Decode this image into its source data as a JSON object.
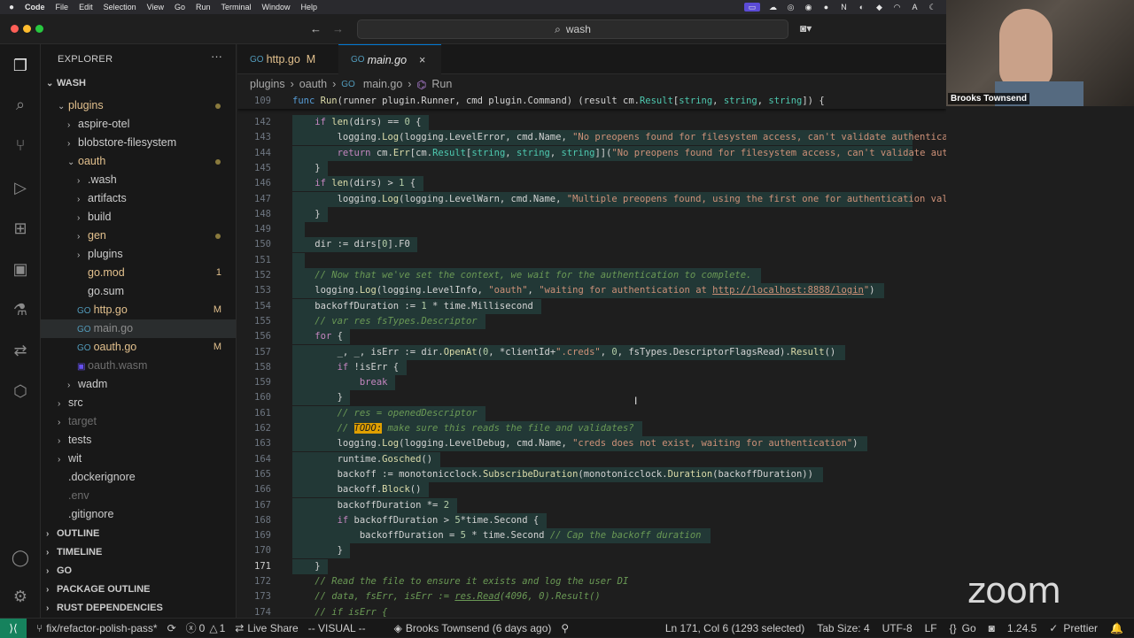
{
  "menubar": {
    "app": "Code",
    "items": [
      "File",
      "Edit",
      "Selection",
      "View",
      "Go",
      "Run",
      "Terminal",
      "Window",
      "Help"
    ]
  },
  "titlebar": {
    "search": "wash"
  },
  "sidebar": {
    "header": "EXPLORER",
    "root": "WASH",
    "tree": [
      {
        "label": "plugins",
        "indent": 1,
        "type": "folder",
        "open": true,
        "color": "#e2c08d",
        "dot": true
      },
      {
        "label": "aspire-otel",
        "indent": 2,
        "type": "folder",
        "open": false,
        "color": "#cccccc"
      },
      {
        "label": "blobstore-filesystem",
        "indent": 2,
        "type": "folder",
        "open": false,
        "color": "#cccccc"
      },
      {
        "label": "oauth",
        "indent": 2,
        "type": "folder",
        "open": true,
        "color": "#e2c08d",
        "dot": true
      },
      {
        "label": ".wash",
        "indent": 3,
        "type": "folder",
        "open": false,
        "color": "#cccccc"
      },
      {
        "label": "artifacts",
        "indent": 3,
        "type": "folder",
        "open": false,
        "color": "#cccccc"
      },
      {
        "label": "build",
        "indent": 3,
        "type": "folder",
        "open": false,
        "color": "#cccccc"
      },
      {
        "label": "gen",
        "indent": 3,
        "type": "folder",
        "open": false,
        "color": "#e2c08d",
        "dot": true
      },
      {
        "label": "plugins",
        "indent": 3,
        "type": "folder",
        "open": false,
        "color": "#cccccc"
      },
      {
        "label": "go.mod",
        "indent": 3,
        "type": "file",
        "color": "#e2c08d",
        "badge": "1"
      },
      {
        "label": "go.sum",
        "indent": 3,
        "type": "file",
        "color": "#cccccc"
      },
      {
        "label": "http.go",
        "indent": 3,
        "type": "go",
        "color": "#e2c08d",
        "badge": "M"
      },
      {
        "label": "main.go",
        "indent": 3,
        "type": "go",
        "color": "#8c8c8c",
        "selected": true
      },
      {
        "label": "oauth.go",
        "indent": 3,
        "type": "go",
        "color": "#e2c08d",
        "badge": "M"
      },
      {
        "label": "oauth.wasm",
        "indent": 3,
        "type": "wasm",
        "color": "#6e6e6e"
      },
      {
        "label": "wadm",
        "indent": 2,
        "type": "folder",
        "open": false,
        "color": "#cccccc"
      },
      {
        "label": "src",
        "indent": 1,
        "type": "folder",
        "open": false,
        "color": "#cccccc"
      },
      {
        "label": "target",
        "indent": 1,
        "type": "folder",
        "open": false,
        "color": "#6e6e6e"
      },
      {
        "label": "tests",
        "indent": 1,
        "type": "folder",
        "open": false,
        "color": "#cccccc"
      },
      {
        "label": "wit",
        "indent": 1,
        "type": "folder",
        "open": false,
        "color": "#cccccc"
      },
      {
        "label": ".dockerignore",
        "indent": 1,
        "type": "file",
        "color": "#cccccc"
      },
      {
        "label": ".env",
        "indent": 1,
        "type": "file",
        "color": "#6e6e6e"
      },
      {
        "label": ".gitignore",
        "indent": 1,
        "type": "file",
        "color": "#cccccc"
      }
    ],
    "sections": [
      "OUTLINE",
      "TIMELINE",
      "GO",
      "PACKAGE OUTLINE",
      "RUST DEPENDENCIES"
    ]
  },
  "tabs": [
    {
      "label": "http.go",
      "badge": "M",
      "active": false
    },
    {
      "label": "main.go",
      "badge": "×",
      "active": true
    }
  ],
  "breadcrumb": [
    "plugins",
    "oauth",
    "main.go",
    "Run"
  ],
  "sticky": {
    "line": "109",
    "text": "func Run(runner plugin.Runner, cmd plugin.Command) (result cm.Result[string, string, string]) {"
  },
  "code": [
    {
      "n": "142",
      "html": "    <span class='kw'>if</span> <span class='fn'>len</span>(dirs) == <span class='num'>0</span> {"
    },
    {
      "n": "143",
      "html": "        logging.<span class='fn'>Log</span>(logging.LevelError, cmd.Name, <span class='str'>\"No preopens found for filesystem access, can't validate authentication\"</span>)"
    },
    {
      "n": "144",
      "html": "        <span class='kw'>return</span> cm.<span class='fn'>Err</span>[cm.<span class='ty'>Result</span>[<span class='ty'>string</span>, <span class='ty'>string</span>, <span class='ty'>string</span>]](<span class='str'>\"No preopens found for filesystem access, can't validate authentication\"</span>)"
    },
    {
      "n": "145",
      "html": "    }"
    },
    {
      "n": "146",
      "html": "    <span class='kw'>if</span> <span class='fn'>len</span>(dirs) > <span class='num'>1</span> {"
    },
    {
      "n": "147",
      "html": "        logging.<span class='fn'>Log</span>(logging.LevelWarn, cmd.Name, <span class='str'>\"Multiple preopens found, using the first one for authentication validation\"</span>)"
    },
    {
      "n": "148",
      "html": "    }"
    },
    {
      "n": "149",
      "html": ""
    },
    {
      "n": "150",
      "html": "    dir := dirs[<span class='num'>0</span>].F0"
    },
    {
      "n": "151",
      "html": ""
    },
    {
      "n": "152",
      "html": "    <span class='cm'>// Now that we've set the context, we wait for the authentication to complete.</span>"
    },
    {
      "n": "153",
      "html": "    logging.<span class='fn'>Log</span>(logging.LevelInfo, <span class='str'>\"oauth\"</span>, <span class='str'>\"waiting for authentication at <u>http://localhost:8888/login</u>\"</span>)"
    },
    {
      "n": "154",
      "html": "    backoffDuration := <span class='num'>1</span> * time.Millisecond"
    },
    {
      "n": "155",
      "html": "    <span class='cm'>// var res fsTypes.Descriptor</span>"
    },
    {
      "n": "156",
      "html": "    <span class='kw'>for</span> {"
    },
    {
      "n": "157",
      "html": "        _, _, isErr := dir.<span class='fn'>OpenAt</span>(<span class='num'>0</span>, *clientId+<span class='str'>\".creds\"</span>, <span class='num'>0</span>, fsTypes.DescriptorFlagsRead).<span class='fn'>Result</span>()"
    },
    {
      "n": "158",
      "html": "        <span class='kw'>if</span> !isErr {"
    },
    {
      "n": "159",
      "html": "            <span class='kw'>break</span>"
    },
    {
      "n": "160",
      "html": "        }"
    },
    {
      "n": "161",
      "html": "        <span class='cm'>// res = openedDescriptor</span>"
    },
    {
      "n": "162",
      "html": "        <span class='cm'>// <span class='todo'>TODO:</span> make sure this reads the file and validates?</span>"
    },
    {
      "n": "163",
      "html": "        logging.<span class='fn'>Log</span>(logging.LevelDebug, cmd.Name, <span class='str'>\"creds does not exist, waiting for authentication\"</span>)"
    },
    {
      "n": "164",
      "html": "        runtime.<span class='fn'>Gosched</span>()"
    },
    {
      "n": "165",
      "html": "        backoff := monotonicclock.<span class='fn'>SubscribeDuration</span>(monotonicclock.<span class='fn'>Duration</span>(backoffDuration))"
    },
    {
      "n": "166",
      "html": "        backoff.<span class='fn'>Block</span>()"
    },
    {
      "n": "167",
      "html": "        backoffDuration *= <span class='num'>2</span>"
    },
    {
      "n": "168",
      "html": "        <span class='kw'>if</span> backoffDuration > <span class='num'>5</span>*time.Second {"
    },
    {
      "n": "169",
      "html": "            backoffDuration = <span class='num'>5</span> * time.Second <span class='cm'>// Cap the backoff duration</span>"
    },
    {
      "n": "170",
      "html": "        }"
    },
    {
      "n": "171",
      "html": "    }"
    },
    {
      "n": "172",
      "html": "    <span class='cm'>// Read the file to ensure it exists and log the user DI</span>"
    },
    {
      "n": "173",
      "html": "    <span class='cm'>// data, fsErr, isErr := <u>res.Read</u>(4096, 0).Result()</span>"
    },
    {
      "n": "174",
      "html": "    <span class='cm'>// if isErr {</span>"
    }
  ],
  "webcam": {
    "name": "Brooks Townsend"
  },
  "overlay": {
    "zoom": "zoom"
  },
  "status": {
    "branch": "fix/refactor-polish-pass*",
    "errors": "0",
    "warnings": "1",
    "liveshare": "Live Share",
    "mode": "-- VISUAL --",
    "blame": "Brooks Townsend (6 days ago)",
    "position": "Ln 171, Col 6 (1293 selected)",
    "tabsize": "Tab Size: 4",
    "encoding": "UTF-8",
    "eol": "LF",
    "language": "Go",
    "goversion": "1.24.5",
    "prettier": "Prettier"
  }
}
